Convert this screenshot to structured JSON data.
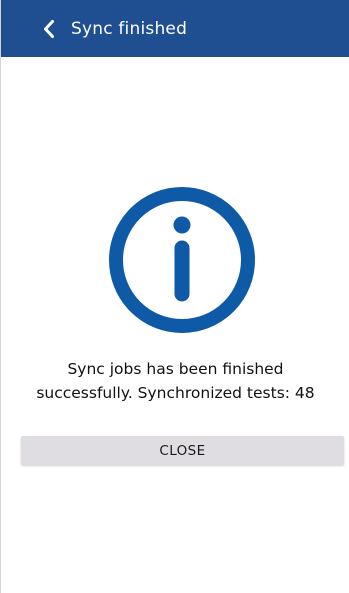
{
  "app_bar": {
    "back_icon": "chevron-left-icon",
    "title": "Sync finished",
    "background": "#1f4f91",
    "text_color": "#ffffff"
  },
  "dialog": {
    "icon": "info-icon",
    "icon_color": "#0e5aa7",
    "message_line1": "Sync jobs has been finished",
    "message_line2": "successfully. Synchronized tests: 48",
    "close_label": "CLOSE"
  }
}
